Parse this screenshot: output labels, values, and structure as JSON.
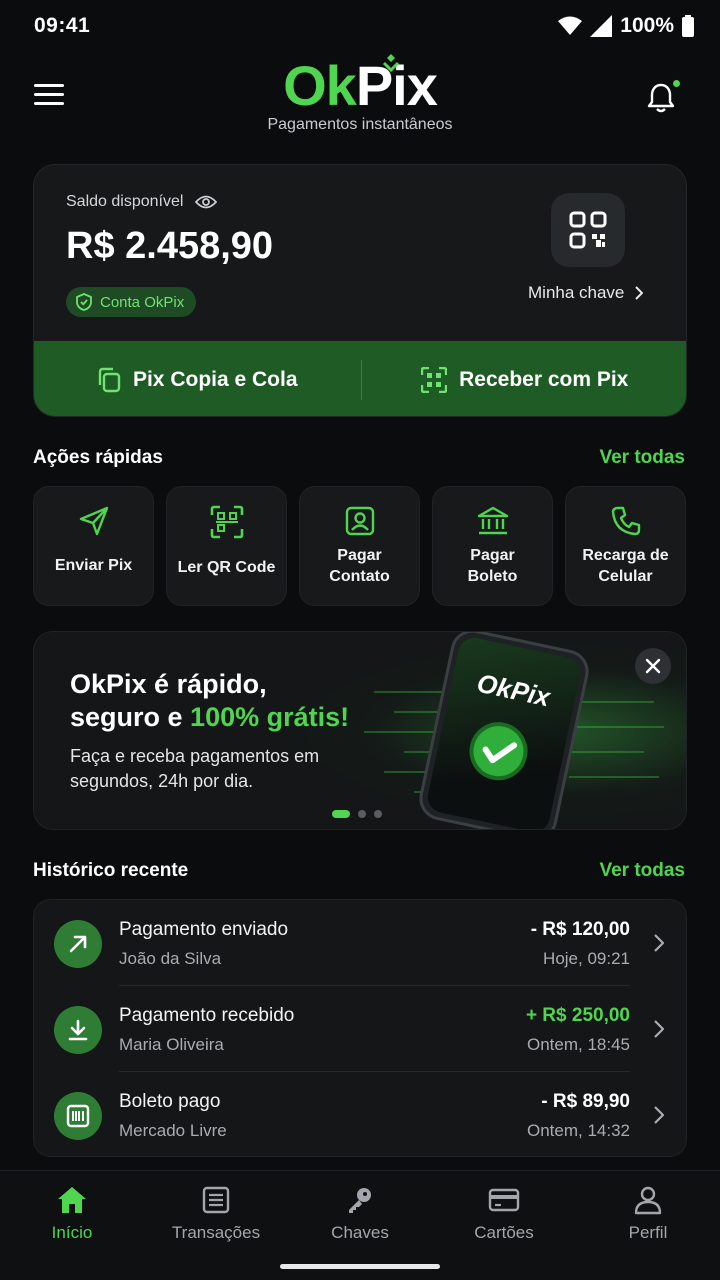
{
  "status_bar": {
    "time": "09:41",
    "battery": "100%"
  },
  "header": {
    "logo_ok": "Ok",
    "logo_pix": "Pix",
    "subtitle": "Pagamentos instantâneos"
  },
  "balance": {
    "label": "Saldo disponível",
    "value": "R$ 2.458,90",
    "badge": "Conta OkPix",
    "key_link": "Minha chave",
    "actions": [
      {
        "label": "Pix Copia e Cola",
        "icon": "copy-icon"
      },
      {
        "label": "Receber com Pix",
        "icon": "qr-scan-icon"
      }
    ]
  },
  "quick_actions": {
    "title": "Ações rápidas",
    "see_all": "Ver todas",
    "items": [
      {
        "label": "Enviar Pix",
        "icon": "send-icon"
      },
      {
        "label": "Ler QR Code",
        "icon": "qr-scan-icon"
      },
      {
        "label": "Pagar\nContato",
        "line1": "Pagar",
        "line2": "Contato",
        "icon": "contact-icon"
      },
      {
        "label": "Pagar\nBoleto",
        "line1": "Pagar",
        "line2": "Boleto",
        "icon": "bank-icon"
      },
      {
        "label": "Recarga de\nCelular",
        "line1": "Recarga de",
        "line2": "Celular",
        "icon": "phone-icon"
      }
    ]
  },
  "promo": {
    "title_line1": "OkPix é rápido,",
    "title_line2_prefix": "seguro e ",
    "title_line2_highlight": "100% grátis!",
    "text": "Faça e receba pagamentos em segundos, 24h por dia.",
    "phone_logo": "OkPix",
    "pages": 3,
    "active_page": 1
  },
  "history": {
    "title": "Histórico recente",
    "see_all": "Ver todas",
    "items": [
      {
        "title": "Pagamento enviado",
        "name": "João da Silva",
        "amount": "- R$ 120,00",
        "time": "Hoje, 09:21",
        "type": "sent",
        "icon": "arrow-up-right-icon"
      },
      {
        "title": "Pagamento recebido",
        "name": "Maria Oliveira",
        "amount": "+ R$ 250,00",
        "time": "Ontem, 18:45",
        "type": "received",
        "icon": "download-icon"
      },
      {
        "title": "Boleto pago",
        "name": "Mercado Livre",
        "amount": "- R$ 89,90",
        "time": "Ontem, 14:32",
        "type": "sent",
        "icon": "barcode-icon"
      }
    ]
  },
  "nav": {
    "items": [
      {
        "label": "Início",
        "icon": "home-icon",
        "active": true
      },
      {
        "label": "Transações",
        "icon": "receipt-icon",
        "active": false
      },
      {
        "label": "Chaves",
        "icon": "key-icon",
        "active": false
      },
      {
        "label": "Cartões",
        "icon": "card-icon",
        "active": false
      },
      {
        "label": "Perfil",
        "icon": "user-icon",
        "active": false
      }
    ]
  },
  "colors": {
    "accent": "#4fd54f",
    "background": "#0b0c0d",
    "card": "#161819",
    "action_bar": "#1f5b24"
  }
}
